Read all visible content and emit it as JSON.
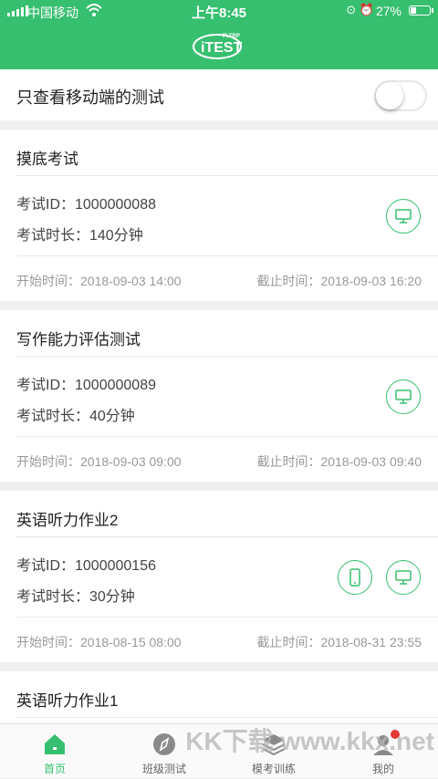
{
  "status_bar": {
    "carrier": "中国移动",
    "time": "上午8:45",
    "battery": "27%"
  },
  "header": {
    "logo_text": "iTEST",
    "logo_sub": "FLTRP"
  },
  "filter": {
    "label": "只查看移动端的测试",
    "enabled": false
  },
  "exams": [
    {
      "title": "摸底考试",
      "id_line": "考试ID：1000000088",
      "duration_line": "考试时长：140分钟",
      "start": "开始时间：2018-09-03 14:00",
      "end": "截止时间：2018-09-03 16:20",
      "icons": [
        "desktop-icon"
      ]
    },
    {
      "title": "写作能力评估测试",
      "id_line": "考试ID：1000000089",
      "duration_line": "考试时长：40分钟",
      "start": "开始时间：2018-09-03 09:00",
      "end": "截止时间：2018-09-03 09:40",
      "icons": [
        "desktop-icon"
      ]
    },
    {
      "title": "英语听力作业2",
      "id_line": "考试ID：1000000156",
      "duration_line": "考试时长：30分钟",
      "start": "开始时间：2018-08-15 08:00",
      "end": "截止时间：2018-08-31 23:55",
      "icons": [
        "mobile-icon",
        "desktop-icon"
      ]
    },
    {
      "title": "英语听力作业1"
    }
  ],
  "tabbar": [
    {
      "label": "首页",
      "icon": "home-icon",
      "active": true
    },
    {
      "label": "班级测试",
      "icon": "compass-icon",
      "active": false
    },
    {
      "label": "模考训练",
      "icon": "layers-icon",
      "active": false
    },
    {
      "label": "我的",
      "icon": "profile-icon",
      "active": false
    }
  ],
  "colors": {
    "brand": "#36bf6f",
    "badge": "#e53935"
  },
  "watermark": "KK下载  www.kkx.net"
}
